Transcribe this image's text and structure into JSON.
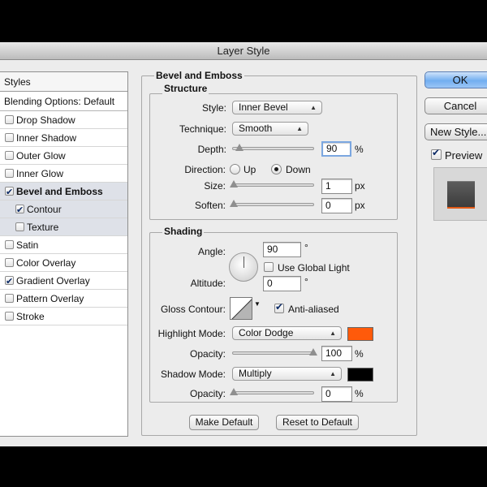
{
  "window": {
    "title": "Layer Style"
  },
  "sidebar": {
    "header": "Styles",
    "blending_options": "Blending Options: Default",
    "items": [
      {
        "label": "Drop Shadow",
        "checked": false
      },
      {
        "label": "Inner Shadow",
        "checked": false
      },
      {
        "label": "Outer Glow",
        "checked": false
      },
      {
        "label": "Inner Glow",
        "checked": false
      },
      {
        "label": "Bevel and Emboss",
        "checked": true,
        "selected": true
      },
      {
        "label": "Contour",
        "checked": true,
        "sub": true
      },
      {
        "label": "Texture",
        "checked": false,
        "sub": true
      },
      {
        "label": "Satin",
        "checked": false
      },
      {
        "label": "Color Overlay",
        "checked": false
      },
      {
        "label": "Gradient Overlay",
        "checked": true
      },
      {
        "label": "Pattern Overlay",
        "checked": false
      },
      {
        "label": "Stroke",
        "checked": false
      }
    ]
  },
  "bevel": {
    "title": "Bevel and Emboss",
    "structure": {
      "title": "Structure",
      "style_label": "Style:",
      "style_value": "Inner Bevel",
      "technique_label": "Technique:",
      "technique_value": "Smooth",
      "depth_label": "Depth:",
      "depth_value": "90",
      "depth_unit": "%",
      "direction_label": "Direction:",
      "direction_up": "Up",
      "direction_down": "Down",
      "direction_selected": "Down",
      "size_label": "Size:",
      "size_value": "1",
      "size_unit": "px",
      "soften_label": "Soften:",
      "soften_value": "0",
      "soften_unit": "px"
    },
    "shading": {
      "title": "Shading",
      "angle_label": "Angle:",
      "angle_value": "90",
      "angle_unit": "°",
      "use_global_light_label": "Use Global Light",
      "use_global_light": false,
      "altitude_label": "Altitude:",
      "altitude_value": "0",
      "altitude_unit": "°",
      "gloss_contour_label": "Gloss Contour:",
      "anti_aliased_label": "Anti-aliased",
      "anti_aliased": true,
      "highlight_mode_label": "Highlight Mode:",
      "highlight_mode_value": "Color Dodge",
      "highlight_color": "#ff5a0a",
      "highlight_opacity_label": "Opacity:",
      "highlight_opacity_value": "100",
      "highlight_opacity_unit": "%",
      "shadow_mode_label": "Shadow Mode:",
      "shadow_mode_value": "Multiply",
      "shadow_color": "#000000",
      "shadow_opacity_label": "Opacity:",
      "shadow_opacity_value": "0",
      "shadow_opacity_unit": "%"
    },
    "make_default": "Make Default",
    "reset_default": "Reset to Default"
  },
  "actions": {
    "ok": "OK",
    "cancel": "Cancel",
    "new_style": "New Style...",
    "preview_label": "Preview",
    "preview_checked": true
  }
}
